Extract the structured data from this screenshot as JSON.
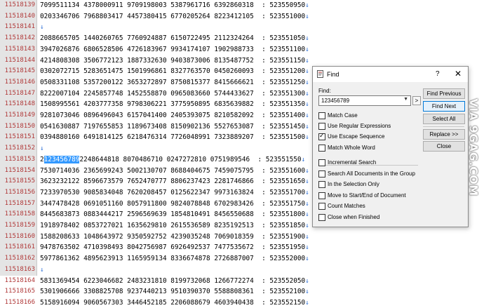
{
  "editor": {
    "lines": [
      {
        "num": "11518139",
        "text": "7099511134 4378000911 9709198003 5387961716 6392860318  : 523550950"
      },
      {
        "num": "11518140",
        "text": "0203346706 7968803417 4457380415 6770205264 8223412105  : 523551000"
      },
      {
        "num": "11518141",
        "text": ""
      },
      {
        "num": "11518142",
        "text": "2088665705 1440260765 7760924887 6150722495 2112324264  : 523551050"
      },
      {
        "num": "11518143",
        "text": "3947026876 6806528506 4726183967 9934174107 1902988733  : 523551100"
      },
      {
        "num": "11518144",
        "text": "4214808308 3506772123 1887332630 9403873006 8135487752  : 523551150"
      },
      {
        "num": "11518145",
        "text": "0302072715 5283651475 1501996861 8327763570 0450260093  : 523551200"
      },
      {
        "num": "11518146",
        "text": "0508331108 5357200122 3653272897 8750815377 8415666621  : 523551250"
      },
      {
        "num": "11518147",
        "text": "8222007104 2245857748 1452558870 0965083660 5744433627  : 523551300"
      },
      {
        "num": "11518148",
        "text": "1508995561 4203777358 9798306221 3775950895 6835639882  : 523551350"
      },
      {
        "num": "11518149",
        "text": "9281073046 0896496043 6157041400 2405393075 8210582092  : 523551400"
      },
      {
        "num": "11518150",
        "text": "0541630887 7197655853 1189673408 8150902136 5527653087  : 523551450"
      },
      {
        "num": "11518151",
        "text": "0394880160 6491814125 6218476314 7726048991 7323889207  : 523551500"
      },
      {
        "num": "11518152",
        "text": ""
      },
      {
        "num": "11518153",
        "text_before": "2",
        "text_selected": "123456789",
        "text": "2248644818 8070486710 0247272810 0751989546  : 523551550"
      },
      {
        "num": "11518154",
        "text": "7530714036 2365699243 5002130707 8688404675 7459075795  : 523551600"
      },
      {
        "num": "11518155",
        "text": "3623232122 8596673579 7652470777 8806237423 2281746866  : 523551650"
      },
      {
        "num": "11518156",
        "text": "7233970530 9085834048 7620208457 0125622347 9973163824  : 523551700"
      },
      {
        "num": "11518157",
        "text": "3447478428 0691051160 8057911800 9824078848 6702983426  : 523551750"
      },
      {
        "num": "11518158",
        "text": "8445683873 0883444217 2596569639 1854810491 8456550688  : 523551800"
      },
      {
        "num": "11518159",
        "text": "1918978402 0853727021 1635629810 2615536589 8235192513  : 523551850"
      },
      {
        "num": "11518160",
        "text": "1588208633 1048643972 9350592752 4239035248 7069018359  : 523551900"
      },
      {
        "num": "11518161",
        "text": "9478763502 4710398493 8042756987 6926492537 7477535672  : 523551950"
      },
      {
        "num": "11518162",
        "text": "5977861362 4895623913 1165959134 8336674878 2726887007  : 523552000"
      },
      {
        "num": "11518163",
        "text": ""
      },
      {
        "num": "11518164",
        "text": "5831369454 6223046682 2483231810 8199732068 1266772274  : 523552050"
      },
      {
        "num": "11518165",
        "text": "5301906666 3308825708 9237440213 9510390370 5588808361  : 523552100"
      },
      {
        "num": "11518166",
        "text": "5158916094 9060567303 3446452185 2206088679 4603940438  : 523552150"
      }
    ],
    "eol_glyph": "↓"
  },
  "watermark": "VIA 9GAG.COM",
  "find_dialog": {
    "title": "Find",
    "help": "?",
    "close": "✕",
    "find_label": "Find:",
    "find_value": "123456789",
    "combo_arrow": "▼",
    "options_arrow": ">",
    "buttons": {
      "find_previous": "Find Previous",
      "find_next": "Find Next",
      "select_all": "Select All",
      "replace": "Replace >>",
      "close": "Close"
    },
    "options": [
      {
        "label": "Match Case",
        "checked": false
      },
      {
        "label": "Use Regular Expressions",
        "checked": false
      },
      {
        "label": "Use Escape Sequence",
        "checked": true
      },
      {
        "label": "Match Whole Word",
        "checked": false
      }
    ],
    "scope_options": [
      {
        "label": "Incremental Search",
        "checked": false
      },
      {
        "label": "Search All Documents in the Group",
        "checked": false
      },
      {
        "label": "In the Selection Only",
        "checked": false
      },
      {
        "label": "Move to Start/End of Document",
        "checked": false
      },
      {
        "label": "Count Matches",
        "checked": false
      },
      {
        "label": "Close when Finished",
        "checked": false
      }
    ]
  }
}
